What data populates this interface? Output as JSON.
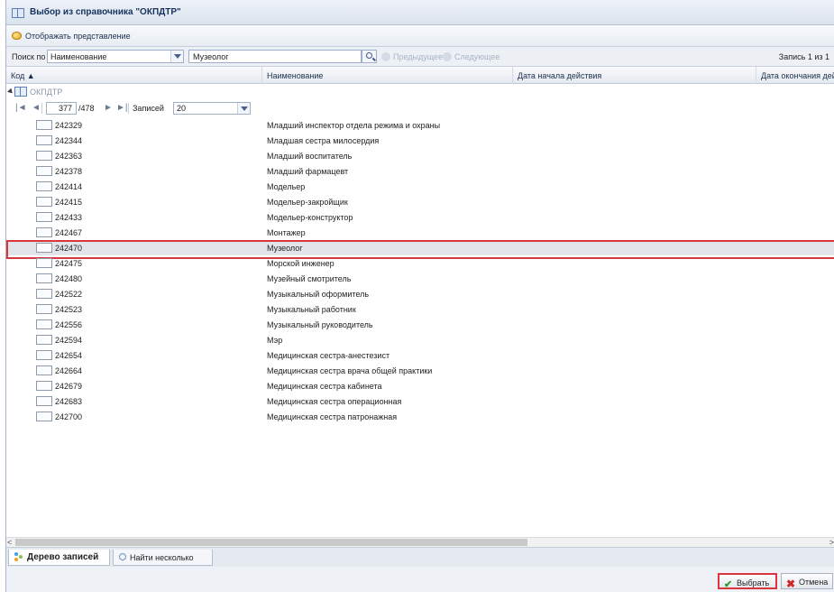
{
  "window": {
    "title": "Выбор из справочника \"ОКПДТР\""
  },
  "toolbar": {
    "view_label": "Отображать представление"
  },
  "search": {
    "label": "Поиск по",
    "field_value": "Наименование",
    "query": "Музеолог",
    "prev_label": "Предыдущее",
    "next_label": "Следующее",
    "counter": "Запись 1 из 1"
  },
  "columns": {
    "code": "Код ▲",
    "name": "Наименование",
    "start_date": "Дата начала действия",
    "end_date": "Дата окончания действия"
  },
  "tree": {
    "root_label": "ОКПДТР"
  },
  "pager": {
    "first": "|◄",
    "prev": "◄",
    "page": "377",
    "total": "/478",
    "next": "►",
    "last": "►|",
    "records_label": "Записей",
    "records_value": "20"
  },
  "rows": [
    {
      "code": "242329",
      "name": "Младший инспектор отдела режима и охраны"
    },
    {
      "code": "242344",
      "name": "Младшая сестра милосердия"
    },
    {
      "code": "242363",
      "name": "Младший воспитатель"
    },
    {
      "code": "242378",
      "name": "Младший фармацевт"
    },
    {
      "code": "242414",
      "name": "Модельер"
    },
    {
      "code": "242415",
      "name": "Модельер-закройщик"
    },
    {
      "code": "242433",
      "name": "Модельер-конструктор"
    },
    {
      "code": "242467",
      "name": "Монтажер"
    },
    {
      "code": "242470",
      "name": "Музеолог"
    },
    {
      "code": "242475",
      "name": "Морской инженер"
    },
    {
      "code": "242480",
      "name": "Музейный смотритель"
    },
    {
      "code": "242522",
      "name": "Музыкальный оформитель"
    },
    {
      "code": "242523",
      "name": "Музыкальный работник"
    },
    {
      "code": "242556",
      "name": "Музыкальный руководитель"
    },
    {
      "code": "242594",
      "name": "Мэр"
    },
    {
      "code": "242654",
      "name": "Медицинская сестра-анестезист"
    },
    {
      "code": "242664",
      "name": "Медицинская сестра врача общей практики"
    },
    {
      "code": "242679",
      "name": "Медицинская сестра кабинета"
    },
    {
      "code": "242683",
      "name": "Медицинская сестра операционная"
    },
    {
      "code": "242700",
      "name": "Медицинская сестра патронажная"
    }
  ],
  "tabs": {
    "tree": "Дерево записей",
    "find_many": "Найти несколько"
  },
  "footer": {
    "select": "Выбрать",
    "cancel": "Отмена"
  },
  "colors": {
    "selection_border": "#d9363e",
    "selected_row": "#e1e4e8",
    "header_bg": "#dbe3ee"
  }
}
